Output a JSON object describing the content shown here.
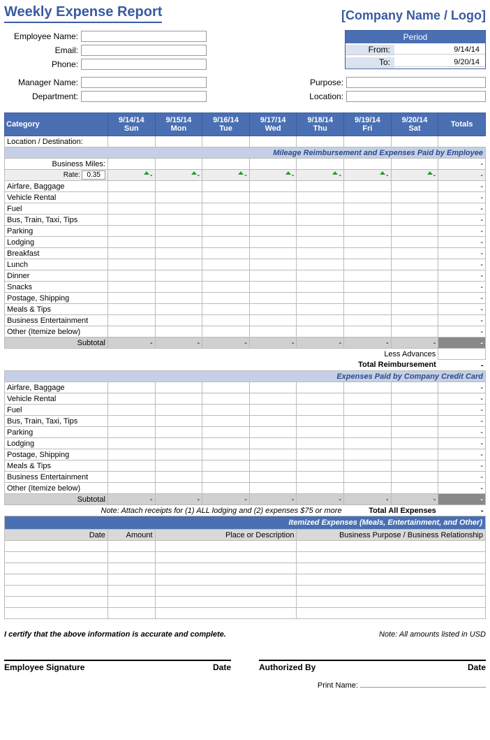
{
  "header": {
    "title": "Weekly Expense Report",
    "company": "[Company Name / Logo]"
  },
  "info": {
    "emp_name_label": "Employee Name:",
    "email_label": "Email:",
    "phone_label": "Phone:",
    "mgr_name_label": "Manager Name:",
    "dept_label": "Department:",
    "purpose_label": "Purpose:",
    "location_label": "Location:"
  },
  "period": {
    "title": "Period",
    "from_label": "From:",
    "to_label": "To:",
    "from_value": "9/14/14",
    "to_value": "9/20/14"
  },
  "columns": {
    "category": "Category",
    "d0": "9/14/14\nSun",
    "d1": "9/15/14\nMon",
    "d2": "9/16/14\nTue",
    "d3": "9/17/14\nWed",
    "d4": "9/18/14\nThu",
    "d5": "9/19/14\nFri",
    "d6": "9/20/14\nSat",
    "totals": "Totals"
  },
  "labels": {
    "loc_dest": "Location / Destination:",
    "section_employee": "Mileage Reimbursement and Expenses Paid by Employee",
    "business_miles": "Business Miles:",
    "rate_label": "Rate:",
    "rate_value": "0.35",
    "subtotal": "Subtotal",
    "less_advances": "Less Advances",
    "total_reimb": "Total Reimbursement",
    "section_cc": "Expenses Paid by Company Credit Card",
    "note_receipts": "Note:  Attach receipts for (1) ALL lodging and (2) expenses $75 or more",
    "total_all": "Total All Expenses",
    "section_itemized": "Itemized Expenses (Meals, Entertainment, and Other)",
    "item_date": "Date",
    "item_amount": "Amount",
    "item_place": "Place or Description",
    "item_purpose": "Business Purpose / Business Relationship",
    "certify": "I certify that the above information is accurate and complete.",
    "amounts_note": "Note: All amounts listed in USD",
    "sig_emp": "Employee Signature",
    "sig_date": "Date",
    "sig_auth": "Authorized By",
    "print_name": "Print Name:"
  },
  "dash": "-",
  "emp_categories": [
    "Airfare, Baggage",
    "Vehicle Rental",
    "Fuel",
    "Bus, Train, Taxi, Tips",
    "Parking",
    "Lodging",
    "Breakfast",
    "Lunch",
    "Dinner",
    "Snacks",
    "Postage, Shipping",
    "Meals & Tips",
    "Business Entertainment",
    "Other (Itemize below)"
  ],
  "cc_categories": [
    "Airfare, Baggage",
    "Vehicle Rental",
    "Fuel",
    "Bus, Train, Taxi, Tips",
    "Parking",
    "Lodging",
    "Postage, Shipping",
    "Meals & Tips",
    "Business Entertainment",
    "Other (Itemize below)"
  ],
  "chart_data": {
    "type": "table",
    "title": "Weekly Expense Report",
    "period": {
      "from": "9/14/14",
      "to": "9/20/14"
    },
    "days": [
      "9/14/14",
      "9/15/14",
      "9/16/14",
      "9/17/14",
      "9/18/14",
      "9/19/14",
      "9/20/14"
    ],
    "employee_paid": {
      "mileage_rate": 0.35,
      "rows": [
        {
          "category": "Business Miles",
          "values": [
            null,
            null,
            null,
            null,
            null,
            null,
            null
          ],
          "total": null
        },
        {
          "category": "Airfare, Baggage",
          "values": [
            null,
            null,
            null,
            null,
            null,
            null,
            null
          ],
          "total": null
        },
        {
          "category": "Vehicle Rental",
          "values": [
            null,
            null,
            null,
            null,
            null,
            null,
            null
          ],
          "total": null
        },
        {
          "category": "Fuel",
          "values": [
            null,
            null,
            null,
            null,
            null,
            null,
            null
          ],
          "total": null
        },
        {
          "category": "Bus, Train, Taxi, Tips",
          "values": [
            null,
            null,
            null,
            null,
            null,
            null,
            null
          ],
          "total": null
        },
        {
          "category": "Parking",
          "values": [
            null,
            null,
            null,
            null,
            null,
            null,
            null
          ],
          "total": null
        },
        {
          "category": "Lodging",
          "values": [
            null,
            null,
            null,
            null,
            null,
            null,
            null
          ],
          "total": null
        },
        {
          "category": "Breakfast",
          "values": [
            null,
            null,
            null,
            null,
            null,
            null,
            null
          ],
          "total": null
        },
        {
          "category": "Lunch",
          "values": [
            null,
            null,
            null,
            null,
            null,
            null,
            null
          ],
          "total": null
        },
        {
          "category": "Dinner",
          "values": [
            null,
            null,
            null,
            null,
            null,
            null,
            null
          ],
          "total": null
        },
        {
          "category": "Snacks",
          "values": [
            null,
            null,
            null,
            null,
            null,
            null,
            null
          ],
          "total": null
        },
        {
          "category": "Postage, Shipping",
          "values": [
            null,
            null,
            null,
            null,
            null,
            null,
            null
          ],
          "total": null
        },
        {
          "category": "Meals & Tips",
          "values": [
            null,
            null,
            null,
            null,
            null,
            null,
            null
          ],
          "total": null
        },
        {
          "category": "Business Entertainment",
          "values": [
            null,
            null,
            null,
            null,
            null,
            null,
            null
          ],
          "total": null
        },
        {
          "category": "Other (Itemize below)",
          "values": [
            null,
            null,
            null,
            null,
            null,
            null,
            null
          ],
          "total": null
        }
      ],
      "subtotal": [
        null,
        null,
        null,
        null,
        null,
        null,
        null,
        null
      ]
    },
    "company_card": {
      "rows": [
        {
          "category": "Airfare, Baggage",
          "values": [
            null,
            null,
            null,
            null,
            null,
            null,
            null
          ],
          "total": null
        },
        {
          "category": "Vehicle Rental",
          "values": [
            null,
            null,
            null,
            null,
            null,
            null,
            null
          ],
          "total": null
        },
        {
          "category": "Fuel",
          "values": [
            null,
            null,
            null,
            null,
            null,
            null,
            null
          ],
          "total": null
        },
        {
          "category": "Bus, Train, Taxi, Tips",
          "values": [
            null,
            null,
            null,
            null,
            null,
            null,
            null
          ],
          "total": null
        },
        {
          "category": "Parking",
          "values": [
            null,
            null,
            null,
            null,
            null,
            null,
            null
          ],
          "total": null
        },
        {
          "category": "Lodging",
          "values": [
            null,
            null,
            null,
            null,
            null,
            null,
            null
          ],
          "total": null
        },
        {
          "category": "Postage, Shipping",
          "values": [
            null,
            null,
            null,
            null,
            null,
            null,
            null
          ],
          "total": null
        },
        {
          "category": "Meals & Tips",
          "values": [
            null,
            null,
            null,
            null,
            null,
            null,
            null
          ],
          "total": null
        },
        {
          "category": "Business Entertainment",
          "values": [
            null,
            null,
            null,
            null,
            null,
            null,
            null
          ],
          "total": null
        },
        {
          "category": "Other (Itemize below)",
          "values": [
            null,
            null,
            null,
            null,
            null,
            null,
            null
          ],
          "total": null
        }
      ],
      "subtotal": [
        null,
        null,
        null,
        null,
        null,
        null,
        null,
        null
      ]
    }
  }
}
